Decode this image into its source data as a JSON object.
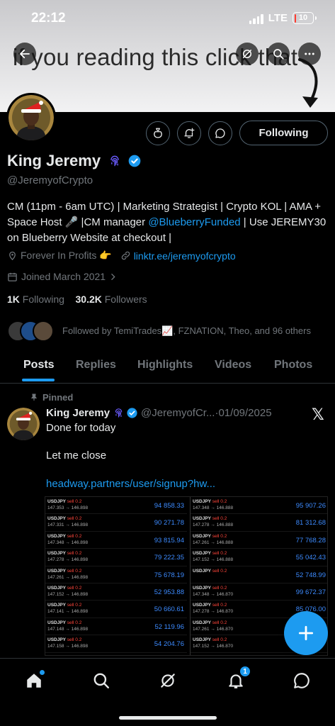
{
  "status_bar": {
    "time": "22:12",
    "network": "LTE",
    "battery": "10",
    "battery_level": 0.1
  },
  "banner": {
    "text": "if you reading this click that"
  },
  "profile": {
    "name": "King Jeremy",
    "handle": "@JeremyofCrypto",
    "following_button": "Following",
    "bio": {
      "part1": "CM (11pm - 6am UTC) | Marketing Strategist | Crypto KOL | AMA + Space Host 🎤 |CM manager ",
      "mention": "@BlueberryFunded",
      "part2": " | Use JEREMY30 on Blueberry Website at checkout |"
    },
    "location": "Forever In Profits 👉",
    "website": "linktr.ee/jeremyofcrypto",
    "joined": "Joined March 2021",
    "following_count": "1K",
    "following_label": "Following",
    "followers_count": "30.2K",
    "followers_label": "Followers",
    "followed_by": "Followed by TemiTrades📈, FZNATION, Theo, and 96 others"
  },
  "tabs": [
    {
      "label": "Posts",
      "active": true
    },
    {
      "label": "Replies"
    },
    {
      "label": "Highlights"
    },
    {
      "label": "Videos"
    },
    {
      "label": "Photos"
    }
  ],
  "tweet": {
    "pinned_label": "Pinned",
    "name": "King Jeremy",
    "handle": "@JeremyofCr...",
    "sep": " · ",
    "date": "01/09/2025",
    "line1": "Done for today",
    "line2": "Let me close",
    "link": "headway.partners/user/signup?hw...",
    "trades_left": [
      {
        "symbol": "USDJPY",
        "side": "sell 0.2",
        "prices": "147.353 → 146.898",
        "profit": "94 858.33"
      },
      {
        "symbol": "USDJPY",
        "side": "sell 0.2",
        "prices": "147.331 → 146.898",
        "profit": "90 271.78"
      },
      {
        "symbol": "USDJPY",
        "side": "sell 0.2",
        "prices": "147.348 → 146.898",
        "profit": "93 815.94"
      },
      {
        "symbol": "USDJPY",
        "side": "sell 0.2",
        "prices": "147.278 → 146.898",
        "profit": "79 222.35"
      },
      {
        "symbol": "USDJPY",
        "side": "sell 0.2",
        "prices": "147.261 → 146.898",
        "profit": "75 678.19"
      },
      {
        "symbol": "USDJPY",
        "side": "sell 0.2",
        "prices": "147.152 → 146.898",
        "profit": "52 953.88"
      },
      {
        "symbol": "USDJPY",
        "side": "sell 0.2",
        "prices": "147.141 → 146.898",
        "profit": "50 660.61"
      },
      {
        "symbol": "USDJPY",
        "side": "sell 0.2",
        "prices": "147.148 → 146.898",
        "profit": "52 119.96"
      },
      {
        "symbol": "USDJPY",
        "side": "sell 0.2",
        "prices": "147.158 → 146.898",
        "profit": "54 204.76"
      }
    ],
    "trades_right": [
      {
        "symbol": "USDJPY",
        "side": "sell 0.2",
        "prices": "147.348 → 146.888",
        "profit": "95 907.26"
      },
      {
        "symbol": "USDJPY",
        "side": "sell 0.2",
        "prices": "147.278 → 146.888",
        "profit": "81 312.68"
      },
      {
        "symbol": "USDJPY",
        "side": "sell 0.2",
        "prices": "147.261 → 146.888",
        "profit": "77 768.28"
      },
      {
        "symbol": "USDJPY",
        "side": "sell 0.2",
        "prices": "147.152 → 146.888",
        "profit": "55 042.43"
      },
      {
        "symbol": "USDJPY",
        "side": "sell 0.2",
        "prices": "",
        "profit": "52 748.99"
      },
      {
        "symbol": "USDJPY",
        "side": "sell 0.2",
        "prices": "147.348 → 146.870",
        "profit": "99 672.37"
      },
      {
        "symbol": "USDJPY",
        "side": "sell 0.2",
        "prices": "147.278 → 146.870",
        "profit": "85 076.00"
      },
      {
        "symbol": "USDJPY",
        "side": "sell 0.2",
        "prices": "147.261 → 146.870",
        "profit": ""
      },
      {
        "symbol": "USDJPY",
        "side": "sell 0.2",
        "prices": "147.152 → 146.870",
        "profit": ""
      }
    ]
  },
  "nav": {
    "notifications_badge": "1"
  },
  "colors": {
    "accent": "#1d9bf0",
    "background": "#000000",
    "muted": "#71767b",
    "loss_red": "#ff453a"
  }
}
